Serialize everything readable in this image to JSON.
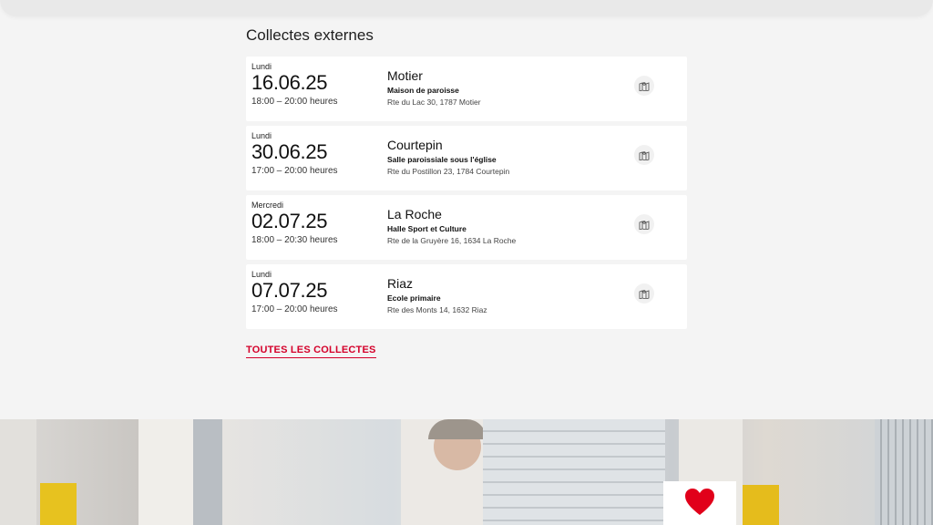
{
  "section": {
    "title": "Collectes externes"
  },
  "collections": [
    {
      "day": "Lundi",
      "date": "16.06.25",
      "time": "18:00 – 20:00  heures",
      "place": "Motier",
      "venue": "Maison de paroisse",
      "address": "Rte du Lac 30, 1787 Motier"
    },
    {
      "day": "Lundi",
      "date": "30.06.25",
      "time": "17:00 – 20:00  heures",
      "place": "Courtepin",
      "venue": "Salle paroissiale sous l'église",
      "address": "Rte du Postillon 23, 1784 Courtepin"
    },
    {
      "day": "Mercredi",
      "date": "02.07.25",
      "time": "18:00 – 20:30  heures",
      "place": "La Roche",
      "venue": "Halle Sport et Culture",
      "address": "Rte de la Gruyère 16, 1634 La Roche"
    },
    {
      "day": "Lundi",
      "date": "07.07.25",
      "time": "17:00 – 20:00  heures",
      "place": "Riaz",
      "venue": "Ecole primaire",
      "address": "Rte des Monts 14, 1632 Riaz"
    }
  ],
  "all_link": "TOUTES LES COLLECTES",
  "icons": {
    "map": "map-icon",
    "heart": "heart-icon"
  },
  "colors": {
    "accent": "#d4002a",
    "background": "#f4f4f4",
    "card": "#ffffff",
    "heart": "#e1001a"
  }
}
